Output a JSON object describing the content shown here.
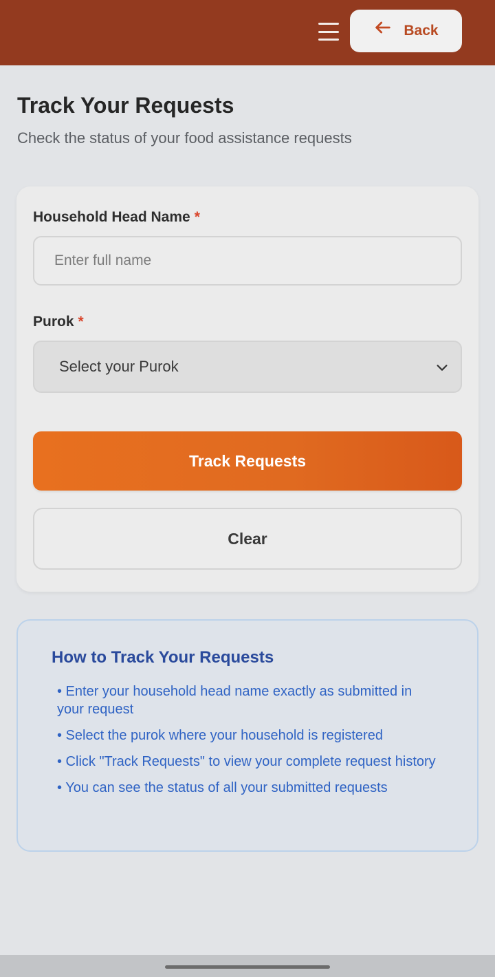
{
  "header": {
    "back_label": "Back"
  },
  "page": {
    "title": "Track Your Requests",
    "subtitle": "Check the status of your food assistance requests"
  },
  "form": {
    "name_label": "Household Head Name",
    "required_mark": "*",
    "name_placeholder": "Enter full name",
    "name_value": "",
    "purok_label": "Purok",
    "purok_selected": "Select your Purok",
    "track_button": "Track Requests",
    "clear_button": "Clear"
  },
  "info": {
    "title": "How to Track Your Requests",
    "items": [
      "• Enter your household head name exactly as submitted in your request",
      "• Select the purok where your household is registered",
      "• Click \"Track Requests\" to view your complete request history",
      "• You can see the status of all your submitted requests"
    ]
  },
  "colors": {
    "header_bg": "#933a1f",
    "accent_orange": "#e8701f",
    "info_blue": "#2f63c4",
    "required_red": "#d9452b"
  },
  "icons": {
    "menu": "hamburger-menu-icon",
    "back": "arrow-left-icon",
    "select": "chevron-down-icon"
  }
}
